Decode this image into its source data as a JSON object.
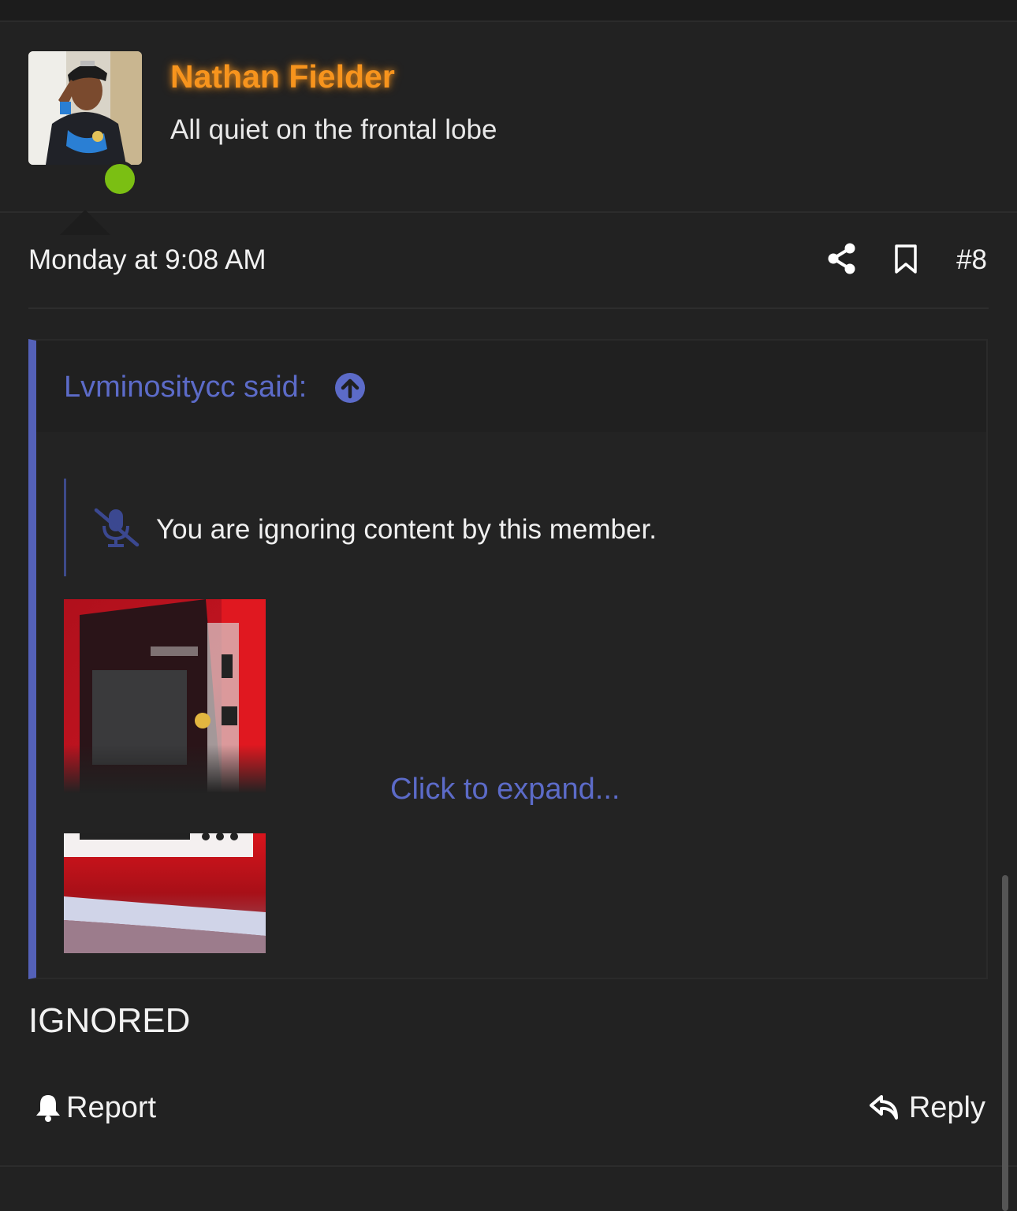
{
  "user": {
    "name": "Nathan Fielder",
    "title": "All quiet on the frontal lobe",
    "online": true,
    "name_color": "#f7941d"
  },
  "post": {
    "date": "Monday at 9:08 AM",
    "number": "#8",
    "body": "IGNORED"
  },
  "quote": {
    "author_label": "Lvminositycc said:",
    "ignored_notice": "You are ignoring content by this member.",
    "expand_label": "Click to expand...",
    "accent_color": "#5461b8"
  },
  "actions": {
    "report_label": "Report",
    "reply_label": "Reply"
  },
  "icons": {
    "share": "share-icon",
    "bookmark": "bookmark-icon",
    "jump": "arrow-up-circle-icon",
    "mute": "microphone-slash-icon",
    "report": "bell-icon",
    "reply": "reply-arrow-icon"
  }
}
